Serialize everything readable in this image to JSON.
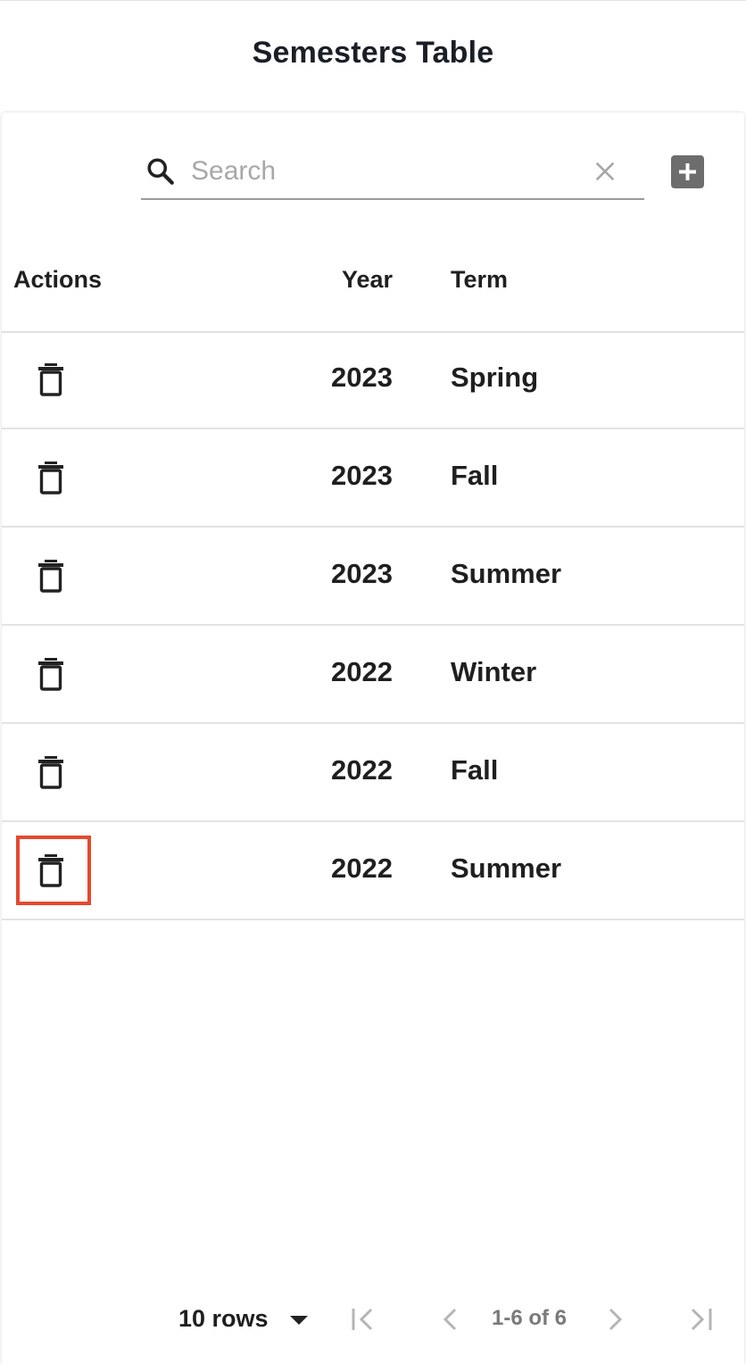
{
  "page": {
    "title": "Semesters Table"
  },
  "search": {
    "placeholder": "Search",
    "value": ""
  },
  "table": {
    "columns": {
      "actions": "Actions",
      "year": "Year",
      "term": "Term"
    },
    "rows": [
      {
        "year": "2023",
        "term": "Spring"
      },
      {
        "year": "2023",
        "term": "Fall"
      },
      {
        "year": "2023",
        "term": "Summer"
      },
      {
        "year": "2022",
        "term": "Winter"
      },
      {
        "year": "2022",
        "term": "Fall"
      },
      {
        "year": "2022",
        "term": "Summer"
      }
    ]
  },
  "pagination": {
    "rows_per_page": "10 rows",
    "range": "1-6 of 6"
  },
  "colors": {
    "highlight": "#e5492f",
    "add_button": "#6d6d6d",
    "icon": "#222222",
    "disabled": "#b5b5b5"
  },
  "icons": {
    "search": "search-icon",
    "clear": "close-icon",
    "add": "plus-icon",
    "delete": "trash-icon",
    "dropdown": "caret-down-icon",
    "first": "first-page-icon",
    "prev": "chevron-left-icon",
    "next": "chevron-right-icon",
    "last": "last-page-icon"
  }
}
